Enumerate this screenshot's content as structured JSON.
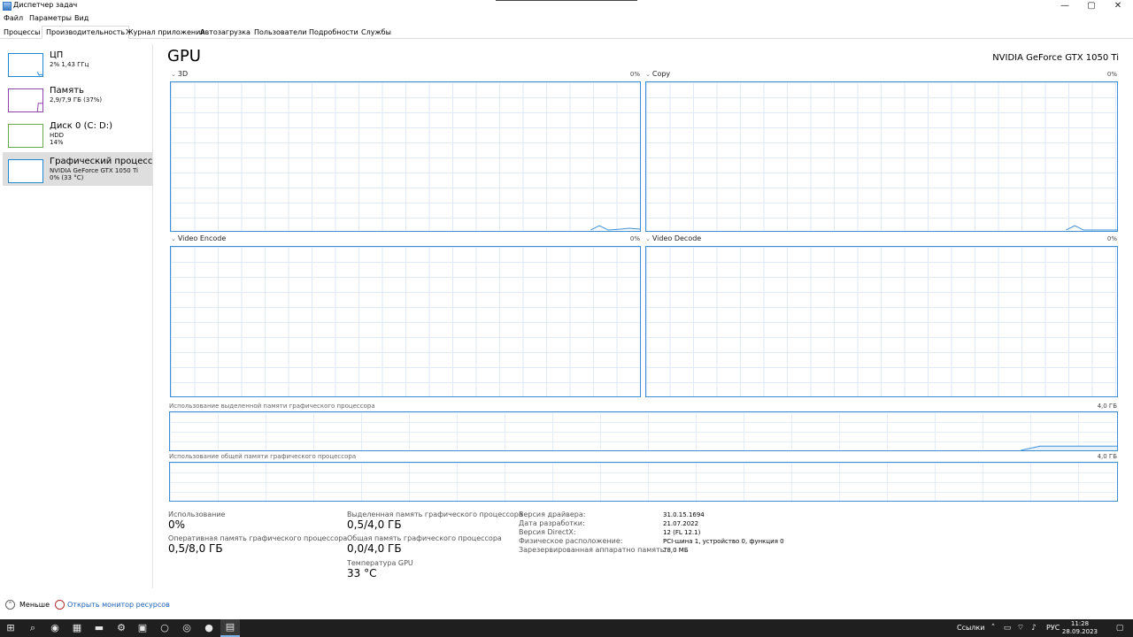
{
  "window": {
    "title": "Диспетчер задач",
    "controls": {
      "minimize": "—",
      "maximize": "▢",
      "close": "✕"
    }
  },
  "menu": [
    "Файл",
    "Параметры",
    "Вид"
  ],
  "tabs": [
    "Процессы",
    "Производительность",
    "Журнал приложений",
    "Автозагрузка",
    "Пользователи",
    "Подробности",
    "Службы"
  ],
  "active_tab": "Производительность",
  "sidebar": {
    "items": [
      {
        "name": "ЦП",
        "line1": "2% 1,43 ГГц",
        "line2": "",
        "color": "#1e88d4"
      },
      {
        "name": "Память",
        "line1": "2,9/7,9 ГБ (37%)",
        "line2": "",
        "color": "#8e44ad"
      },
      {
        "name": "Диск 0 (C: D:)",
        "line1": "HDD",
        "line2": "14%",
        "color": "#6aa84f"
      },
      {
        "name": "Графический процесс",
        "line1": "NVIDIA GeForce GTX 1050 Ti",
        "line2": "0% (33 °C)",
        "color": "#1e88d4"
      }
    ],
    "selected_index": 3
  },
  "main": {
    "title": "GPU",
    "model": "NVIDIA GeForce GTX 1050 Ti",
    "engines": [
      {
        "name": "3D",
        "percent": "0%"
      },
      {
        "name": "Copy",
        "percent": "0%"
      },
      {
        "name": "Video Encode",
        "percent": "0%"
      },
      {
        "name": "Video Decode",
        "percent": "0%"
      }
    ],
    "dedicated_memory": {
      "label": "Использование выделенной памяти графического процессора",
      "max": "4,0 ГБ"
    },
    "shared_memory": {
      "label": "Использование общей памяти графического процессора",
      "max": "4,0 ГБ"
    },
    "stats": {
      "usage_label": "Использование",
      "usage_value": "0%",
      "gpu_ram_label": "Оперативная память графического процессора",
      "gpu_ram_value": "0,5/8,0 ГБ",
      "dedicated_label": "Выделенная память графического процессора",
      "dedicated_value": "0,5/4,0 ГБ",
      "shared_label": "Общая память графического процессора",
      "shared_value": "0,0/4,0 ГБ",
      "temp_label": "Температура GPU",
      "temp_value": "33 °C"
    },
    "info": [
      {
        "key": "Версия драйвера:",
        "value": "31.0.15.1694"
      },
      {
        "key": "Дата разработки:",
        "value": "21.07.2022"
      },
      {
        "key": "Версия DirectX:",
        "value": "12 (FL 12.1)"
      },
      {
        "key": "Физическое расположение:",
        "value": "PCI-шина 1, устройство 0, функция 0"
      },
      {
        "key": "Зарезервированная аппаратно память:",
        "value": "78,0 МБ"
      }
    ]
  },
  "footer": {
    "less_label": "Меньше",
    "monitor_link": "Открыть монитор ресурсов"
  },
  "taskbar": {
    "links_label": "Ссылки",
    "language": "РУС",
    "time": "11:28",
    "date": "28.09.2023"
  },
  "colors": {
    "accent": "#3c8fd6",
    "grid": "#dfeaf6",
    "selected": "#dedede",
    "taskbar": "#1f1f1f"
  }
}
